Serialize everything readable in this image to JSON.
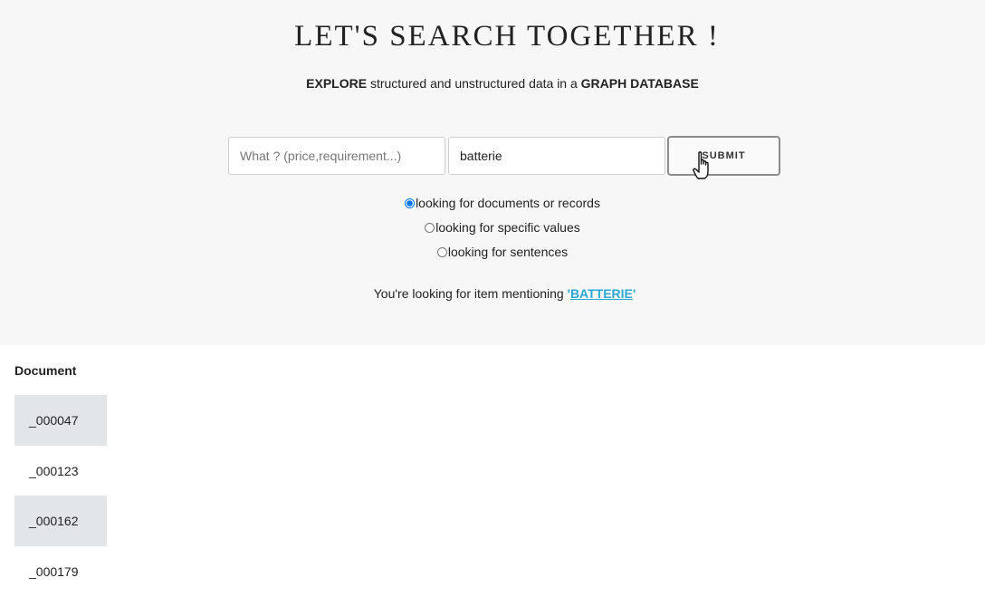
{
  "header": {
    "title": "LET'S SEARCH TOGETHER !",
    "subtitle_prefix": "EXPLORE",
    "subtitle_middle": " structured and unstructured data in a ",
    "subtitle_suffix": "GRAPH DATABASE"
  },
  "search": {
    "what_placeholder": "What ? (price,requirement...)",
    "what_value": "",
    "term_value": "batterie",
    "submit_label": "SUBMIT"
  },
  "modes": [
    {
      "label": "looking for documents or records",
      "selected": true
    },
    {
      "label": "looking for specific values",
      "selected": false
    },
    {
      "label": "looking for sentences",
      "selected": false
    }
  ],
  "mention": {
    "prefix": "You're looking for item mentioning ",
    "open_quote": "'",
    "term": "BATTERIE",
    "close_quote": "'"
  },
  "results": {
    "column_header": "Document",
    "rows": [
      "_000047",
      "_000123",
      "_000162",
      "_000179"
    ]
  },
  "colors": {
    "accent": "#2aa9d6",
    "hero_background": "#f7f7f7",
    "row_shade": "#e3e6e9"
  },
  "icons": {
    "cursor": "hand-pointer-icon"
  }
}
